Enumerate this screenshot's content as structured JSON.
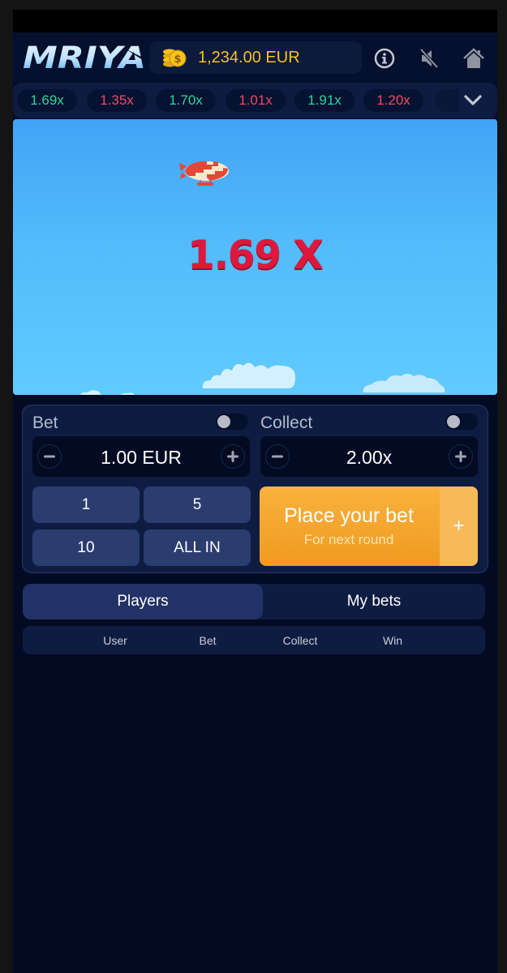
{
  "header": {
    "logo": "MRIYA",
    "balance": "1,234.00 EUR",
    "icons": [
      "info-icon",
      "sound-muted-icon",
      "home-icon"
    ]
  },
  "history": {
    "items": [
      {
        "value": "1.69x",
        "color": "#2ad69a"
      },
      {
        "value": "1.35x",
        "color": "#f2495f"
      },
      {
        "value": "1.70x",
        "color": "#2ad69a"
      },
      {
        "value": "1.01x",
        "color": "#f2495f"
      },
      {
        "value": "1.91x",
        "color": "#2ad69a"
      },
      {
        "value": "1.20x",
        "color": "#f2495f"
      }
    ],
    "expand_icon": "chevron-down-icon"
  },
  "game": {
    "multiplier": "1.69 X",
    "multiplier_color": "#e0173c"
  },
  "bet_panel": {
    "bet": {
      "label": "Bet",
      "auto_toggle": false,
      "value": "1.00 EUR"
    },
    "collect": {
      "label": "Collect",
      "auto_toggle": false,
      "value": "2.00x"
    },
    "quick_amounts": [
      "1",
      "5",
      "10",
      "ALL IN"
    ],
    "place_button": {
      "title": "Place your bet",
      "subtitle": "For next round",
      "extra": "+",
      "color": "#f5a52d"
    }
  },
  "tabs": [
    {
      "label": "Players",
      "active": true
    },
    {
      "label": "My bets",
      "active": false
    }
  ],
  "table": {
    "columns": [
      "User",
      "Bet",
      "Collect",
      "Win"
    ],
    "rows": []
  }
}
